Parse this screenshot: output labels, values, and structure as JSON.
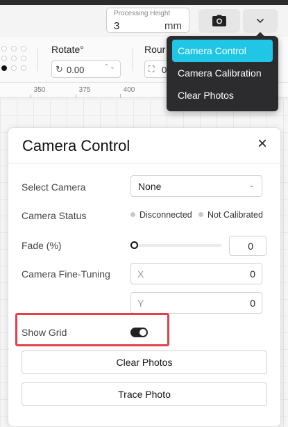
{
  "toolbar": {
    "processing_height": {
      "label": "Processing Height",
      "value": "3",
      "unit": "mm"
    },
    "camera_button_icon": "camera-icon",
    "dropdown_icon": "chevron-down-icon"
  },
  "properties": {
    "rotate": {
      "label": "Rotate°",
      "value": "0.00"
    },
    "round": {
      "label": "Rour",
      "value": "0"
    }
  },
  "ruler": {
    "ticks": [
      "350",
      "375",
      "400"
    ]
  },
  "camera_menu": {
    "items": [
      {
        "label": "Camera Control",
        "active": true
      },
      {
        "label": "Camera Calibration",
        "active": false
      },
      {
        "label": "Clear Photos",
        "active": false
      }
    ],
    "accent_color": "#1fc6e6"
  },
  "panel": {
    "title": "Camera Control",
    "select_camera": {
      "label": "Select Camera",
      "value": "None"
    },
    "camera_status": {
      "label": "Camera Status",
      "connection": "Disconnected",
      "calibration": "Not Calibrated"
    },
    "fade": {
      "label": "Fade (%)",
      "value": "0"
    },
    "fine_tuning": {
      "label": "Camera Fine-Tuning",
      "x_axis": "X",
      "x_value": "0",
      "y_axis": "Y",
      "y_value": "0"
    },
    "show_grid": {
      "label": "Show Grid",
      "enabled": true
    },
    "clear_photos_label": "Clear Photos",
    "trace_photo_label": "Trace Photo",
    "highlight_color": "#e5404a"
  }
}
